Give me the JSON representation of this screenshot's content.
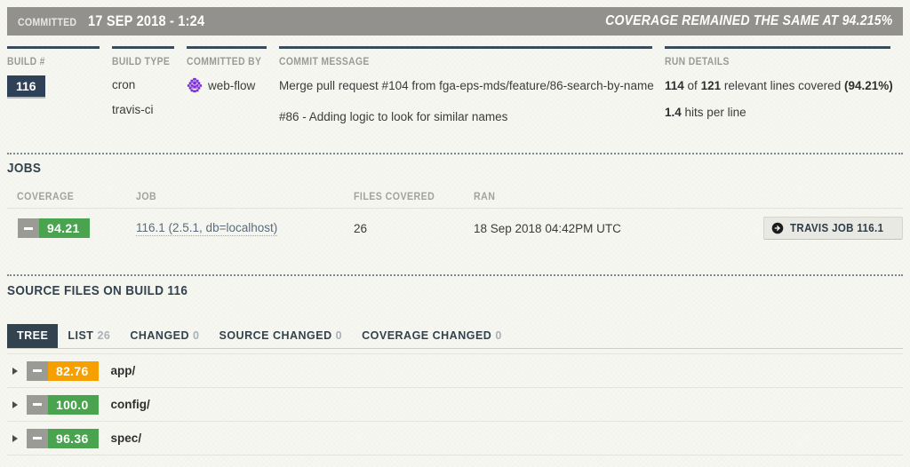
{
  "header": {
    "committed_label": "COMMITTED",
    "committed_date": "17 SEP 2018 - 1:24",
    "coverage_status": "COVERAGE REMAINED THE SAME AT 94.215%",
    "bar_color": "#92918d"
  },
  "meta": {
    "build": {
      "heading": "BUILD #",
      "value": "116"
    },
    "build_type": {
      "heading": "BUILD TYPE",
      "line1": "cron",
      "line2": "travis-ci"
    },
    "committed_by": {
      "heading": "COMMITTED BY",
      "user": "web-flow",
      "avatar": "identicon-avatar"
    },
    "commit_message": {
      "heading": "COMMIT MESSAGE",
      "line1": "Merge pull request #104 from fga-eps-mds/feature/86-search-by-name",
      "line2": "#86 - Adding logic to look for similar names"
    },
    "run_details": {
      "heading": "RUN DETAILS",
      "covered_lines": "114",
      "of_text": "of",
      "relevant_lines": "121",
      "lines_text": "relevant lines covered",
      "percent": "(94.21%)",
      "hits_value": "1.4",
      "hits_text": "hits per line"
    }
  },
  "jobs": {
    "title": "JOBS",
    "columns": {
      "coverage": "COVERAGE",
      "job": "JOB",
      "files_covered": "FILES COVERED",
      "ran": "RAN"
    },
    "rows": [
      {
        "coverage": "94.21",
        "coverage_color": "#4aa34f",
        "trend": "no-change-dash",
        "job": "116.1 (2.5.1, db=localhost)",
        "files_covered": "26",
        "ran": "18 Sep 2018 04:42PM UTC",
        "button_label": "TRAVIS JOB 116.1",
        "button_icon": "arrow-circle-right-icon"
      }
    ]
  },
  "source_files": {
    "title": "SOURCE FILES ON BUILD 116",
    "tabs": [
      {
        "label": "TREE",
        "count": "",
        "active": true
      },
      {
        "label": "LIST",
        "count": "26",
        "active": false
      },
      {
        "label": "CHANGED",
        "count": "0",
        "active": false
      },
      {
        "label": "SOURCE CHANGED",
        "count": "0",
        "active": false
      },
      {
        "label": "COVERAGE CHANGED",
        "count": "0",
        "active": false
      }
    ],
    "tree": [
      {
        "name": "app/",
        "coverage": "82.76",
        "coverage_color": "#f5a000",
        "trend": "no-change-dash"
      },
      {
        "name": "config/",
        "coverage": "100.0",
        "coverage_color": "#4aa34f",
        "trend": "no-change-dash"
      },
      {
        "name": "spec/",
        "coverage": "96.36",
        "coverage_color": "#4aa34f",
        "trend": "no-change-dash"
      }
    ]
  }
}
